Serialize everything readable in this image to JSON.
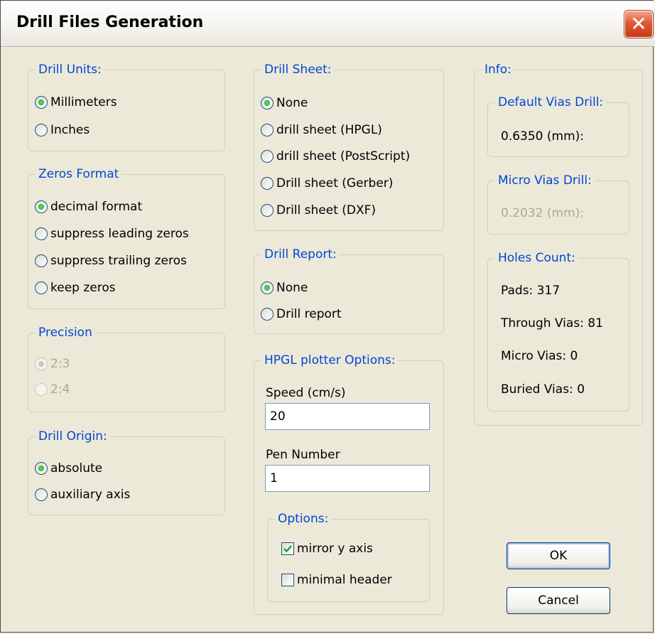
{
  "window": {
    "title": "Drill Files Generation",
    "close_label": "✕"
  },
  "drill_units": {
    "legend": "Drill Units:",
    "options": [
      "Millimeters",
      "Inches"
    ],
    "selected": "Millimeters"
  },
  "zeros_format": {
    "legend": "Zeros Format",
    "options": [
      "decimal format",
      "suppress leading zeros",
      "suppress trailing zeros",
      "keep zeros"
    ],
    "selected": "decimal format"
  },
  "precision": {
    "legend": "Precision",
    "options": [
      "2:3",
      "2:4"
    ],
    "selected": "2:3",
    "disabled": true
  },
  "drill_origin": {
    "legend": "Drill Origin:",
    "options": [
      "absolute",
      "auxiliary axis"
    ],
    "selected": "absolute"
  },
  "drill_sheet": {
    "legend": "Drill Sheet:",
    "options": [
      "None",
      "drill sheet (HPGL)",
      "drill sheet (PostScript)",
      "Drill sheet (Gerber)",
      "Drill sheet (DXF)"
    ],
    "selected": "None"
  },
  "drill_report": {
    "legend": "Drill Report:",
    "options": [
      "None",
      "Drill report"
    ],
    "selected": "None"
  },
  "hpgl": {
    "legend": "HPGL plotter Options:",
    "speed_label": "Speed (cm/s)",
    "speed_value": "20",
    "pen_label": "Pen Number",
    "pen_value": "1",
    "options_legend": "Options:",
    "mirror_label": "mirror y axis",
    "mirror_checked": true,
    "minimal_label": "minimal header",
    "minimal_checked": false
  },
  "info": {
    "legend": "Info:",
    "default_vias": {
      "legend": "Default Vias Drill:",
      "value": "0.6350 (mm):"
    },
    "micro_vias": {
      "legend": "Micro Vias Drill:",
      "value": "0.2032 (mm):",
      "disabled": true
    },
    "holes_count": {
      "legend": "Holes Count:",
      "pads": "Pads: 317",
      "through_vias": "Through Vias: 81",
      "micro_vias": "Micro Vias: 0",
      "buried_vias": "Buried Vias: 0"
    }
  },
  "buttons": {
    "ok": "OK",
    "cancel": "Cancel"
  }
}
